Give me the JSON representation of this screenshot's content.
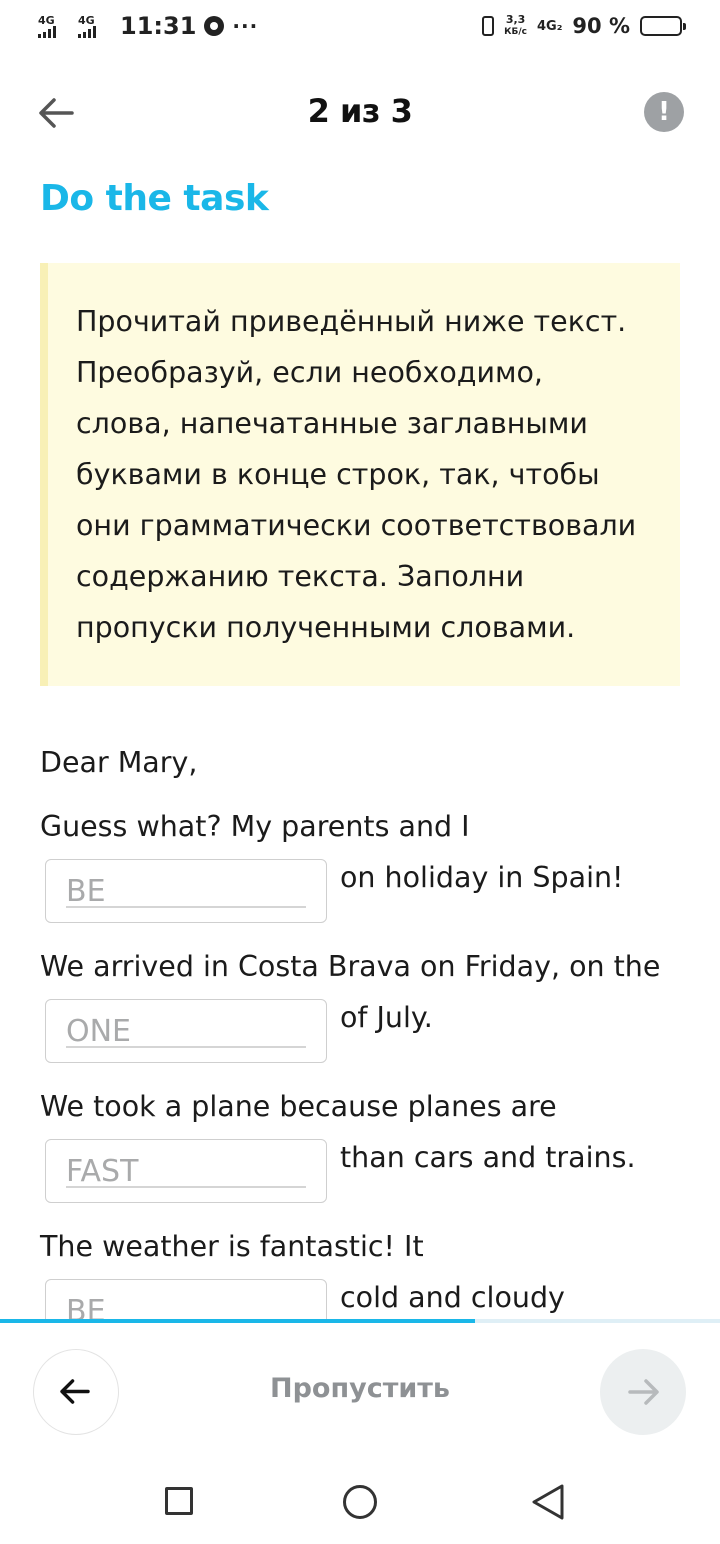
{
  "status_bar": {
    "sim1_network": "4G",
    "sim2_network": "4G",
    "time": "11:31",
    "more": "···",
    "speed_value": "3,3",
    "speed_unit": "КБ/с",
    "data_network": "4G₂",
    "battery_percent": "90 %",
    "battery_level": 0.9
  },
  "header": {
    "counter": "2 из 3",
    "report_symbol": "!"
  },
  "task": {
    "title": "Do the task",
    "instruction_lines": [
      "Прочитай приведённый ниже текст.",
      "Преобразуй, если необходимо,",
      "слова, напечатанные заглавными",
      "буквами в конце строк, так, чтобы",
      "они грамматически соответствовали",
      "содержанию текста. Заполни",
      "пропуски полученными словами."
    ]
  },
  "exercise": {
    "greeting": "Dear Mary,",
    "items": [
      {
        "before": "Guess what? My parents and I",
        "placeholder": "BE",
        "after": "on holiday in Spain!"
      },
      {
        "before": "We arrived in Costa Brava on Friday, on the",
        "placeholder": "ONE",
        "after": "of July."
      },
      {
        "before": "We took a plane because planes are",
        "placeholder": "FAST",
        "after": "than cars and trains."
      },
      {
        "before": "The weather is fantastic! It",
        "placeholder": "BE",
        "after": "cold and cloudy"
      }
    ]
  },
  "progress": {
    "fraction": 0.66
  },
  "footer": {
    "skip_label": "Пропустить"
  },
  "colors": {
    "accent": "#1ab7e8",
    "instruction_bg": "#fefbe0",
    "instruction_border": "#f8f0b6",
    "muted": "#8e9194"
  },
  "icons": {
    "back": "arrow-left-icon",
    "report": "exclamation-icon",
    "prev": "arrow-left-icon",
    "next": "arrow-right-icon",
    "nav_recent": "square-icon",
    "nav_home": "circle-icon",
    "nav_back": "triangle-back-icon"
  }
}
